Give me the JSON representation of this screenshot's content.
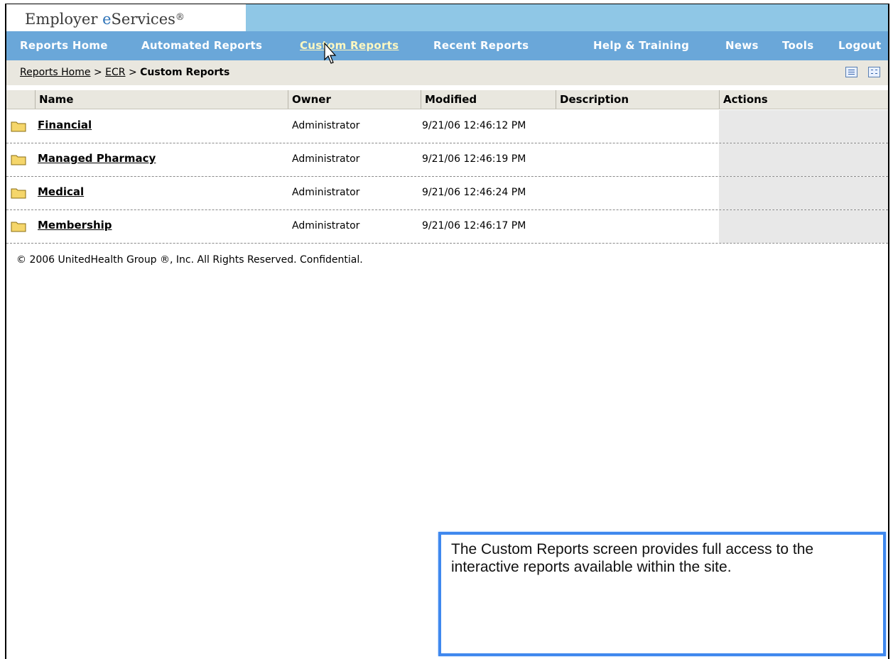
{
  "app": {
    "brand_prefix": "Employer ",
    "brand_e": "e",
    "brand_suffix": "Services",
    "brand_mark": "®"
  },
  "nav": {
    "items": [
      {
        "label": "Reports Home"
      },
      {
        "label": "Automated Reports"
      },
      {
        "label": "Custom Reports",
        "active": true
      },
      {
        "label": "Recent Reports"
      },
      {
        "label": "Help & Training"
      },
      {
        "label": "News"
      },
      {
        "label": "Tools"
      },
      {
        "label": "Logout"
      }
    ]
  },
  "breadcrumb": {
    "home": "Reports Home",
    "sep": ">",
    "ecr": "ECR",
    "current": "Custom Reports"
  },
  "view_icons": [
    "list-view-icon",
    "detail-view-icon"
  ],
  "table": {
    "headers": [
      "Name",
      "Owner",
      "Modified",
      "Description",
      "Actions"
    ],
    "rows": [
      {
        "name": "Financial",
        "owner": "Administrator",
        "modified": "9/21/06 12:46:12 PM",
        "description": ""
      },
      {
        "name": "Managed Pharmacy",
        "owner": "Administrator",
        "modified": "9/21/06 12:46:19 PM",
        "description": ""
      },
      {
        "name": "Medical",
        "owner": "Administrator",
        "modified": "9/21/06 12:46:24 PM",
        "description": ""
      },
      {
        "name": "Membership",
        "owner": "Administrator",
        "modified": "9/21/06 12:46:17 PM",
        "description": ""
      }
    ]
  },
  "footer": {
    "copyright": "© 2006 UnitedHealth Group ®, Inc. All Rights Reserved. Confidential."
  },
  "callout": {
    "text": "The Custom Reports screen provides full access to the interactive reports available within the site."
  },
  "colors": {
    "brand_bar": "#8fc7e6",
    "nav_bar": "#6aa7d9",
    "active_nav": "#fff8c0",
    "callout_border": "#3f88ee",
    "folder": "#f5d66b"
  }
}
